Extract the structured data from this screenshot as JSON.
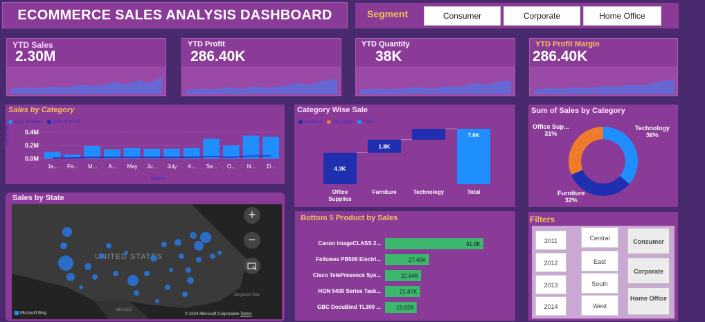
{
  "header": {
    "title": "ECOMMERCE SALES ANALYSIS DASHBOARD"
  },
  "segment": {
    "label": "Segment",
    "options": [
      "Consumer",
      "Corporate",
      "Home Office"
    ]
  },
  "kpis": [
    {
      "label": "YTD Sales",
      "value": "2.30M"
    },
    {
      "label": "YTD Profit",
      "value": "286.40K"
    },
    {
      "label": "YTD Quantity",
      "value": "38K"
    },
    {
      "label": "YTD Profit Margin",
      "value": "286.40K"
    }
  ],
  "sales_by_category_bar": {
    "title": "Sales by Category",
    "legend": [
      "Sum of Sales",
      "Sum of Profit"
    ],
    "ylabel": "Sum of Sal...",
    "xlabel": "Month",
    "yticks": [
      "0.4M",
      "0.2M",
      "0.0M"
    ]
  },
  "category_wise": {
    "title": "Category Wise Sale",
    "legend": [
      "Increase",
      "Decrease",
      "Total"
    ]
  },
  "donut": {
    "title": "Sum of Sales by Category",
    "labels": [
      {
        "name": "Office Sup...",
        "pct": "31%"
      },
      {
        "name": "Technology",
        "pct": "36%"
      },
      {
        "name": "Furniture",
        "pct": "32%"
      }
    ]
  },
  "map": {
    "title": "Sales by State",
    "country_label": "UNITED STATES",
    "mexico": "MEXICO",
    "sargasso": "Sargasso Sea",
    "bing": "Microsoft Bing",
    "copyright": "© 2024 Microsoft Corporation",
    "terms": "Terms",
    "zoom_in": "+",
    "zoom_out": "−"
  },
  "bottom5": {
    "title": "Bottom 5 Product by Sales"
  },
  "filters": {
    "title": "Filters",
    "years": [
      "2011",
      "2012",
      "2013",
      "2014"
    ],
    "regions": [
      "Central",
      "East",
      "South",
      "West"
    ],
    "segments": [
      "Consumer",
      "Corporate",
      "Home Office"
    ]
  },
  "chart_data": [
    {
      "type": "bar",
      "title": "Sales by Category",
      "categories": [
        "Ja...",
        "Fe...",
        "M...",
        "A...",
        "May",
        "Ju...",
        "July",
        "A...",
        "Se...",
        "O...",
        "N...",
        "D..."
      ],
      "series": [
        {
          "name": "Sum of Sales",
          "values": [
            0.1,
            0.06,
            0.19,
            0.14,
            0.16,
            0.15,
            0.15,
            0.16,
            0.3,
            0.2,
            0.35,
            0.33
          ]
        },
        {
          "name": "Sum of Profit",
          "values": [
            0.01,
            0.01,
            0.02,
            0.02,
            0.02,
            0.02,
            0.02,
            0.02,
            0.03,
            0.02,
            0.04,
            0.04
          ]
        }
      ],
      "xlabel": "Month",
      "ylabel": "Sum of Sal...",
      "ylim": [
        0,
        0.4
      ]
    },
    {
      "type": "bar",
      "title": "Category Wise Sale",
      "categories": [
        "Office Supplies",
        "Furniture",
        "Technology",
        "Total"
      ],
      "values": [
        4.3,
        1.8,
        1.5,
        7.6
      ],
      "labels": [
        "4.3K",
        "1.8K",
        "",
        "7.6K"
      ],
      "legend": [
        "Increase",
        "Decrease",
        "Total"
      ]
    },
    {
      "type": "pie",
      "title": "Sum of Sales by Category",
      "categories": [
        "Technology",
        "Furniture",
        "Office Sup..."
      ],
      "values": [
        36,
        32,
        31
      ],
      "colors": [
        "#1f8fff",
        "#1f2fb0",
        "#ef7b2d"
      ]
    },
    {
      "type": "bar",
      "title": "Bottom 5 Product by Sales",
      "categories": [
        "Canon imageCLASS 2...",
        "Fellowes PB500 Electri...",
        "Cisco TelePresence Sys...",
        "HON 5400 Series Task...",
        "GBC DocuBind TL300 ..."
      ],
      "values": [
        61.6,
        27.45,
        22.64,
        21.87,
        19.82
      ],
      "labels": [
        "61.6K",
        "27.45K",
        "22.64K",
        "21.87K",
        "19.82K"
      ]
    }
  ],
  "colors": {
    "panel": "#8a3a97",
    "accent": "#f1c15a",
    "bar": "#1f8fff",
    "green_bar": "#3cb86e"
  }
}
